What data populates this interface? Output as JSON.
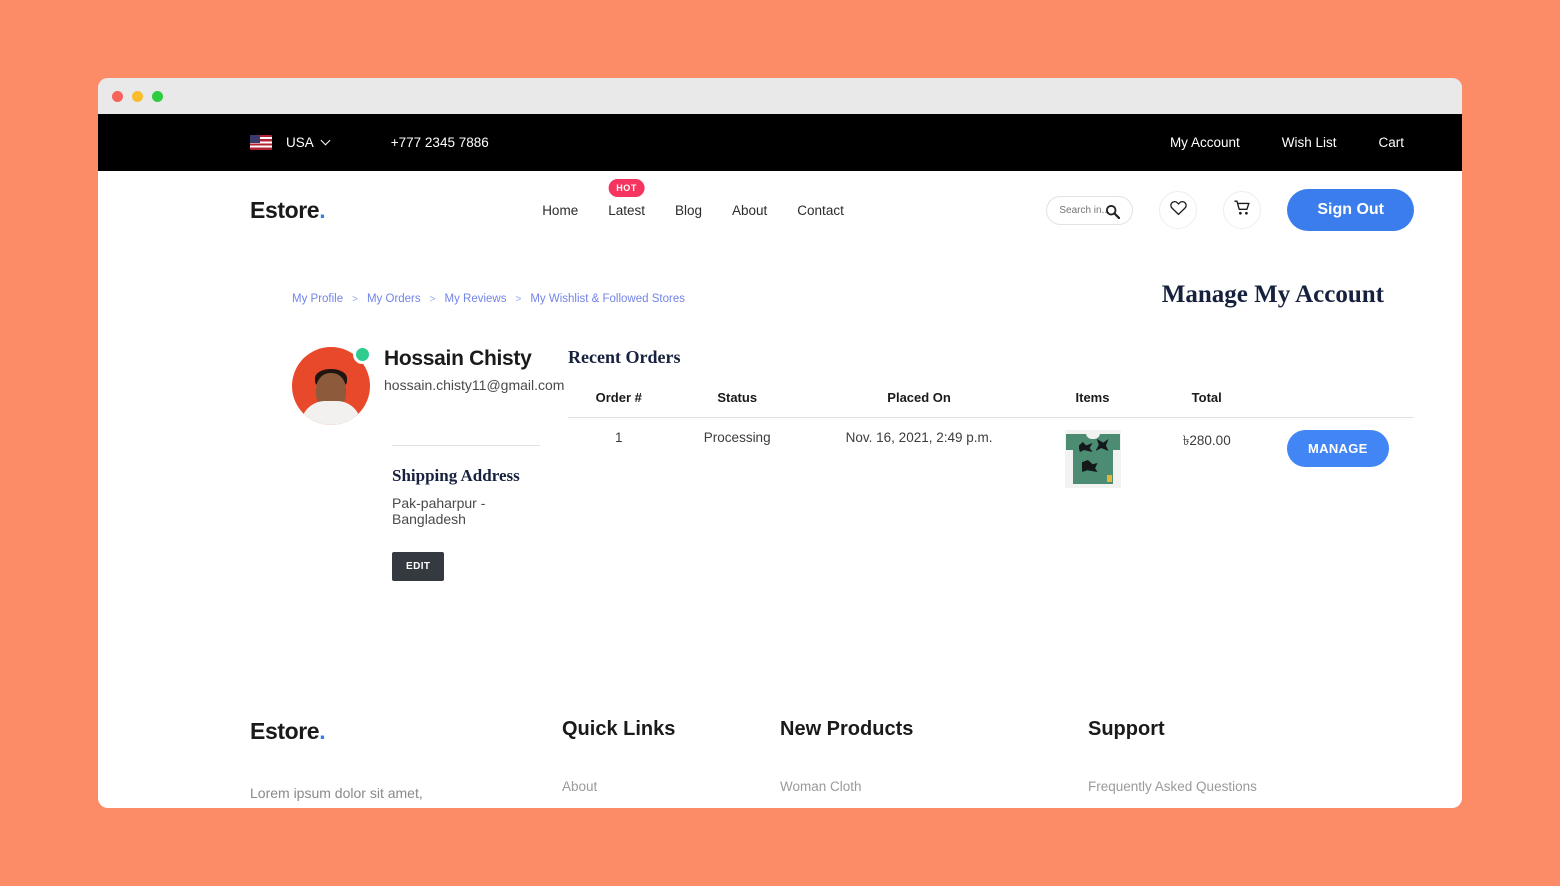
{
  "window": {
    "traffic_lights": [
      "close",
      "minimize",
      "maximize"
    ]
  },
  "topbar": {
    "flag": "us-flag-icon",
    "country": "USA",
    "phone": "+777 2345 7886",
    "links": [
      {
        "label": "My Account"
      },
      {
        "label": "Wish List"
      },
      {
        "label": "Cart"
      }
    ]
  },
  "header": {
    "logo": "Estore",
    "logo_dot": ".",
    "nav": [
      {
        "label": "Home",
        "badge": ""
      },
      {
        "label": "Latest",
        "badge": "HOT"
      },
      {
        "label": "Blog",
        "badge": ""
      },
      {
        "label": "About",
        "badge": ""
      },
      {
        "label": "Contact",
        "badge": ""
      }
    ],
    "search": {
      "value": "",
      "placeholder": "Search in..."
    },
    "wishlist_icon": "heart-icon",
    "cart_icon": "cart-icon",
    "signout_label": "Sign Out"
  },
  "breadcrumb": {
    "items": [
      {
        "label": "My Profile"
      },
      {
        "label": "My Orders"
      },
      {
        "label": "My Reviews"
      },
      {
        "label": "My Wishlist & Followed Stores"
      }
    ],
    "separator": ">"
  },
  "page_title": "Manage My Account",
  "profile": {
    "name": "Hossain Chisty",
    "email": "hossain.chisty11@gmail.com",
    "status": "online",
    "shipping_title": "Shipping Address",
    "shipping_address": "Pak-paharpur - Bangladesh",
    "edit_label": "EDIT"
  },
  "orders": {
    "title": "Recent Orders",
    "columns": [
      "Order #",
      "Status",
      "Placed On",
      "Items",
      "Total",
      ""
    ],
    "rows": [
      {
        "order_no": "1",
        "status": "Processing",
        "placed_on": "Nov. 16, 2021, 2:49 p.m.",
        "item_image": "green-tshirt-thumbnail",
        "total": "৳280.00",
        "action_label": "MANAGE"
      }
    ]
  },
  "footer": {
    "logo": "Estore",
    "logo_dot": ".",
    "tagline": "Lorem ipsum dolor sit amet,",
    "columns": [
      {
        "heading": "Quick Links",
        "links": [
          "About"
        ]
      },
      {
        "heading": "New Products",
        "links": [
          "Woman Cloth"
        ]
      },
      {
        "heading": "Support",
        "links": [
          "Frequently Asked Questions"
        ]
      }
    ]
  },
  "colors": {
    "page_background": "#FC8C68",
    "accent_blue": "#3B7DED",
    "manage_blue": "#4285F4",
    "hot_badge": "#F5355F",
    "dark_button": "#343A40",
    "avatar_bg": "#E8492B",
    "status_green": "#2ECC8F",
    "breadcrumb_link": "#7384E8",
    "heading_navy": "#16213E"
  }
}
